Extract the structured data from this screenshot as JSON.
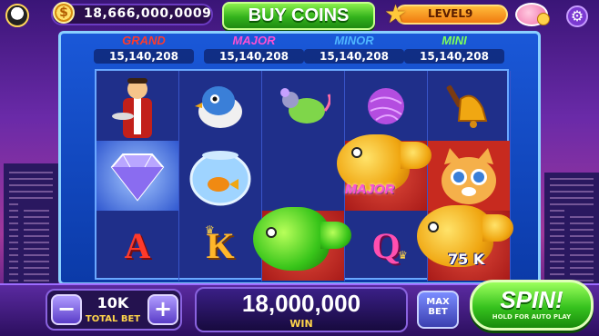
{
  "topbar": {
    "coin_symbol": "$",
    "coins": "18,666,000,0009",
    "buy_coins_label": "BUY COINS",
    "level_label": "LEVEL9",
    "settings_icon": "gear-icon",
    "star_icon": "star-icon",
    "piggy_icon": "piggy-bank-icon",
    "avatar_icon": "panda-avatar-icon"
  },
  "jackpots": [
    {
      "name": "GRAND",
      "value": "15,140,208",
      "color": "#ff3a2a"
    },
    {
      "name": "MAJOR",
      "value": "15,140,208",
      "color": "#ff4fd2"
    },
    {
      "name": "MINOR",
      "value": "15,140,208",
      "color": "#4fb6ff"
    },
    {
      "name": "MINI",
      "value": "15,140,208",
      "color": "#7dff5a"
    }
  ],
  "reels": {
    "symbols_row1": [
      "butler-icon",
      "bird-icon",
      "mouse-icon",
      "yarn-ball-icon",
      "bell-icon"
    ],
    "symbols_row2": [
      "diamond-icon",
      "fishbowl-icon",
      "empty",
      "goldfish-icon",
      "kitten-icon"
    ],
    "symbols_row3": [
      "A",
      "K",
      "green-fish-icon",
      "Q",
      "goldfish-icon"
    ],
    "major_tag": "MAJOR",
    "win_tag": "75 K"
  },
  "bottombar": {
    "minus_label": "−",
    "plus_label": "+",
    "bet_value": "10K",
    "bet_label": "TOTAL BET",
    "win_value": "18,000,000",
    "win_label": "WIN",
    "max_top": "MAX",
    "max_bottom": "BET",
    "spin_label": "SPIN!",
    "spin_hint": "HOLD FOR AUTO PLAY"
  },
  "colors": {
    "accent_green": "#36c21e",
    "frame_blue": "#1a58d8",
    "gold": "#ffd54a"
  }
}
